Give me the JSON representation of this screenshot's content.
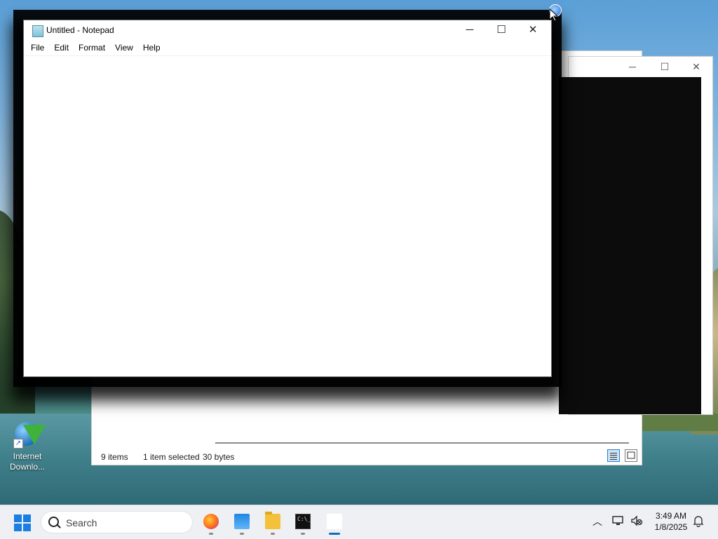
{
  "desktop": {
    "icons": [
      {
        "label_line1": "Internet",
        "label_line2": "Downlo..."
      }
    ]
  },
  "explorer": {
    "status": {
      "items": "9 items",
      "selected": "1 item selected",
      "size": "30 bytes"
    }
  },
  "terminal": {
    "minimize": "─",
    "maximize": "☐",
    "close": "✕"
  },
  "notepad": {
    "title": "Untitled - Notepad",
    "minimize": "─",
    "maximize": "☐",
    "close": "✕",
    "menu": [
      "File",
      "Edit",
      "Format",
      "View",
      "Help"
    ],
    "content": ""
  },
  "taskbar": {
    "search_placeholder": "Search",
    "apps": [
      {
        "name": "Firefox",
        "icon": "firefox-icon",
        "running": true
      },
      {
        "name": "Task View / Photos",
        "icon": "explorer-icon",
        "running": true
      },
      {
        "name": "File Explorer",
        "icon": "folder-icon",
        "running": true
      },
      {
        "name": "Command Prompt",
        "icon": "cmd-icon",
        "running": true
      },
      {
        "name": "Notepad",
        "icon": "notepad-icon",
        "running": true,
        "active": true
      }
    ],
    "tray": {
      "chevron": "︿",
      "time": "3:49 AM",
      "date": "1/8/2025"
    }
  },
  "colors": {
    "accent": "#0a6fc2",
    "taskbar_bg": "#eef0f3",
    "terminal_bg": "#0c0c0c"
  }
}
